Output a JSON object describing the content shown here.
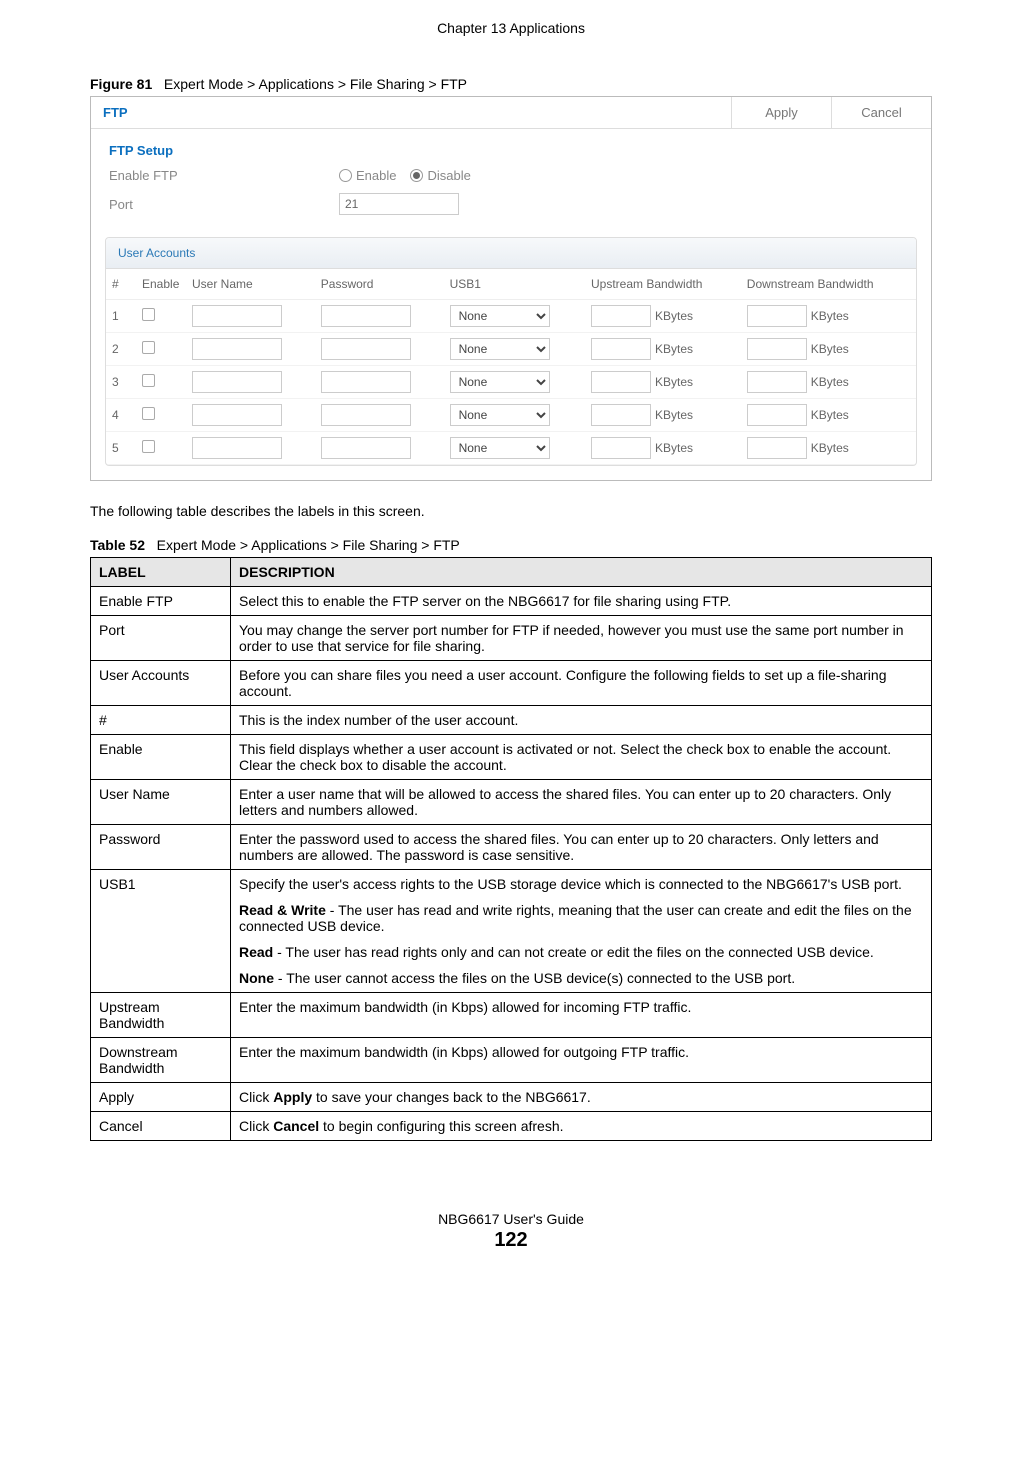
{
  "chapter_header": "Chapter 13 Applications",
  "figure_label": "Figure 81",
  "figure_title": "Expert Mode > Applications > File Sharing > FTP",
  "screenshot": {
    "panel_title": "FTP",
    "apply_btn": "Apply",
    "cancel_btn": "Cancel",
    "section_title": "FTP Setup",
    "enable_label": "Enable FTP",
    "enable_option": "Enable",
    "disable_option": "Disable",
    "port_label": "Port",
    "port_value": "21",
    "user_accounts_title": "User Accounts",
    "cols": {
      "idx": "#",
      "enable": "Enable",
      "user": "User Name",
      "pass": "Password",
      "usb": "USB1",
      "up": "Upstream Bandwidth",
      "down": "Downstream Bandwidth"
    },
    "usb_option": "None",
    "kbytes": "KBytes",
    "rows": [
      "1",
      "2",
      "3",
      "4",
      "5"
    ]
  },
  "intro_text": "The following table describes the labels in this screen.",
  "table_label": "Table 52",
  "table_title": "Expert Mode > Applications > File Sharing > FTP",
  "th_label": "LABEL",
  "th_desc": "DESCRIPTION",
  "rows": {
    "r1l": "Enable FTP",
    "r1d": "Select this to enable the FTP server on the NBG6617 for file sharing using FTP.",
    "r2l": "Port",
    "r2d": "You may change the server port number for FTP if needed, however you must use the same port number in order to use that service for file sharing.",
    "r3l": "User Accounts",
    "r3d": "Before you can share files you need a user account. Configure the following fields to set up a file-sharing account.",
    "r4l": "#",
    "r4d": "This is the index number of the user account.",
    "r5l": "Enable",
    "r5d": "This field displays whether a user account is activated or not. Select the check box to enable the account. Clear the check box to disable the account.",
    "r6l": "User Name",
    "r6d": "Enter a user name that will be allowed to access the shared files. You can enter up to 20 characters. Only letters and numbers allowed.",
    "r7l": "Password",
    "r7d": "Enter the password used to access the shared files. You can enter up to 20 characters. Only letters and numbers are allowed. The password is case sensitive.",
    "r8l": "USB1",
    "r8d1": "Specify the user's access rights to the USB storage device which is connected to the NBG6617's USB port.",
    "r8d2a": "Read & Write",
    "r8d2b": " - The user has read and write rights, meaning that the user can create and edit the files on the connected USB device.",
    "r8d3a": "Read",
    "r8d3b": " - The user has read rights only and can not create or edit the files on the connected USB device.",
    "r8d4a": "None",
    "r8d4b": " - The user cannot access the files on the USB device(s) connected to the USB port.",
    "r9l": "Upstream Bandwidth",
    "r9d": "Enter the maximum bandwidth (in Kbps) allowed for incoming FTP traffic.",
    "r10l": "Downstream Bandwidth",
    "r10d": "Enter the maximum bandwidth (in Kbps) allowed for outgoing FTP traffic.",
    "r11l": "Apply",
    "r11d1": "Click ",
    "r11d2": "Apply",
    "r11d3": " to save your changes back to the NBG6617.",
    "r12l": "Cancel",
    "r12d1": "Click ",
    "r12d2": "Cancel",
    "r12d3": " to begin configuring this screen afresh."
  },
  "footer_guide": "NBG6617 User's Guide",
  "footer_page": "122"
}
